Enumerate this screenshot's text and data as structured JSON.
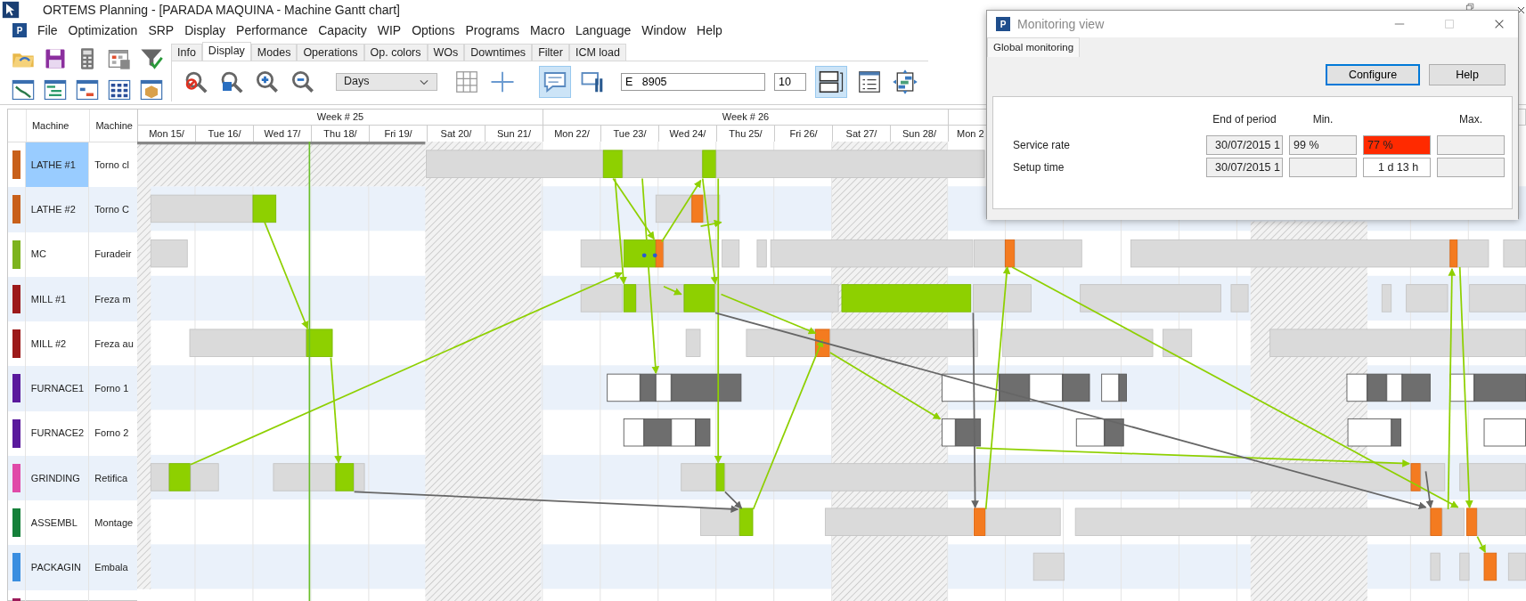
{
  "window": {
    "title": "ORTEMS  Planning - [PARADA MAQUINA - Machine Gantt chart]"
  },
  "menu_logo": "P",
  "menu": [
    "File",
    "Optimization",
    "SRP",
    "Display",
    "Performance",
    "Capacity",
    "WIP",
    "Options",
    "Programs",
    "Macro",
    "Language",
    "Window",
    "Help"
  ],
  "toolbar_tabs": [
    {
      "label": "Info",
      "selected": false
    },
    {
      "label": "Display",
      "selected": true
    },
    {
      "label": "Modes",
      "selected": false
    },
    {
      "label": "Operations",
      "selected": false
    },
    {
      "label": "Op. colors",
      "selected": false
    },
    {
      "label": "WOs",
      "selected": false
    },
    {
      "label": "Downtimes",
      "selected": false
    },
    {
      "label": "Filter",
      "selected": false
    },
    {
      "label": "ICM load",
      "selected": false
    }
  ],
  "toolbar": {
    "scale": "Days",
    "search_value": "E   8905",
    "count_value": "10",
    "comments_on": true,
    "layout_on": true
  },
  "grid": {
    "columns": [
      "Machine",
      "Machine"
    ],
    "weeks": [
      "Week # 25",
      "Week # 26"
    ],
    "days": [
      "Mon 15/",
      "Tue 16/",
      "Wed 17/",
      "Thu 18/",
      "Fri 19/",
      "Sat 20/",
      "Sun 21/",
      "Mon 22/",
      "Tue 23/",
      "Wed 24/",
      "Thu 25/",
      "Fri 26/",
      "Sat 27/",
      "Sun 28/",
      "Mon 2"
    ],
    "machines": [
      {
        "code": "LATHE #1",
        "description": "Torno cl",
        "color": "#c8601a",
        "selected": true
      },
      {
        "code": "LATHE #2",
        "description": "Torno C",
        "color": "#c8601a",
        "selected": false
      },
      {
        "code": "MC",
        "description": "Furadeir",
        "color": "#7db31e",
        "selected": false
      },
      {
        "code": "MILL #1",
        "description": "Freza m",
        "color": "#9c1a1a",
        "selected": false
      },
      {
        "code": "MILL #2",
        "description": "Freza au",
        "color": "#9c1a1a",
        "selected": false
      },
      {
        "code": "FURNACE1",
        "description": "Forno 1",
        "color": "#5a1a9c",
        "selected": false
      },
      {
        "code": "FURNACE2",
        "description": "Forno 2",
        "color": "#5a1a9c",
        "selected": false
      },
      {
        "code": "GRINDING",
        "description": "Retifica",
        "color": "#e04aa8",
        "selected": false
      },
      {
        "code": "ASSEMBL",
        "description": "Montage",
        "color": "#15803a",
        "selected": false
      },
      {
        "code": "PACKAGIN",
        "description": "Embala",
        "color": "#3a8ee0",
        "selected": false
      },
      {
        "color": "#9b1b5a"
      }
    ]
  },
  "monitoring": {
    "logo": "P",
    "title": "Monitoring view",
    "tabs": [
      {
        "label": "Global monitoring",
        "selected": true
      }
    ],
    "buttons": [
      {
        "label": "Configure",
        "focused": true
      },
      {
        "label": "Help",
        "focused": false
      }
    ],
    "columns": [
      "End of period",
      "Min.",
      "Max."
    ],
    "rows": [
      {
        "label": "Service rate",
        "end_of_period": "30/07/2015 1",
        "min": "99  %",
        "value": "77 %",
        "alert": true
      },
      {
        "label": "Setup time",
        "end_of_period": "30/07/2015 1",
        "value": "1 d 13 h",
        "alert": false
      }
    ]
  }
}
